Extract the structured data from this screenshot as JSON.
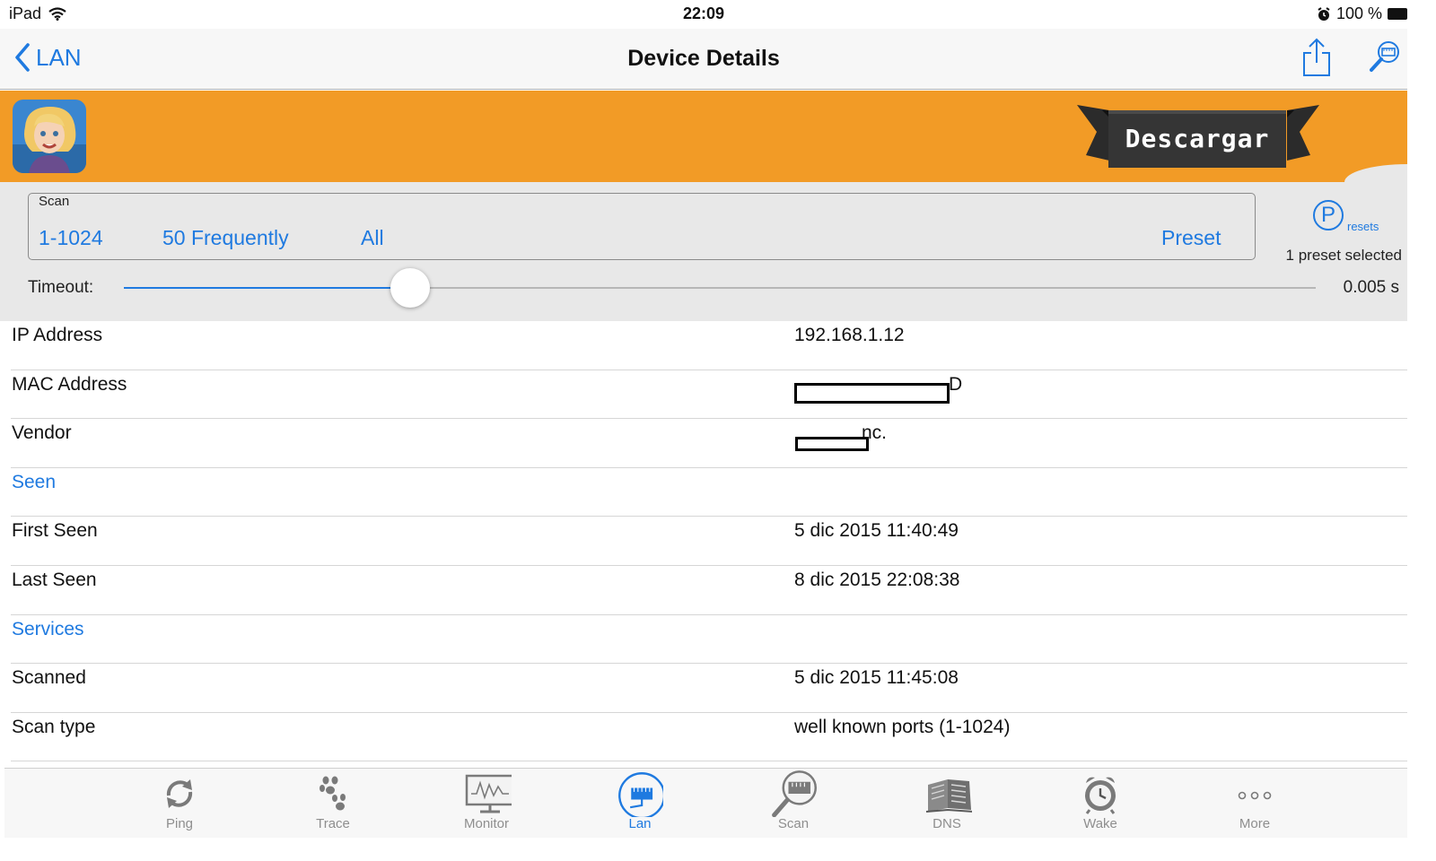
{
  "status_bar": {
    "device": "iPad",
    "time": "22:09",
    "battery": "100 %"
  },
  "nav": {
    "back_label": "LAN",
    "title": "Device Details"
  },
  "ad": {
    "button_label": "Descargar"
  },
  "scan": {
    "legend": "Scan",
    "options": [
      "1-1024",
      "50 Frequently",
      "All",
      "Preset"
    ],
    "presets_letter": "P",
    "presets_label": "resets",
    "preset_status": "1 preset selected",
    "timeout_label": "Timeout:",
    "timeout_value": "0.005 s",
    "timeout_fraction": 0.24
  },
  "details": {
    "ip_label": "IP Address",
    "ip_value": "192.168.1.12",
    "mac_label": "MAC Address",
    "mac_value": "D",
    "vendor_label": "Vendor",
    "vendor_value": "nc.",
    "seen_header": "Seen",
    "first_seen_label": "First Seen",
    "first_seen_value": "5 dic 2015 11:40:49",
    "last_seen_label": "Last Seen",
    "last_seen_value": "8 dic 2015 22:08:38",
    "services_header": "Services",
    "scanned_label": "Scanned",
    "scanned_value": "5 dic 2015 11:45:08",
    "scan_type_label": "Scan type",
    "scan_type_value": "well known ports (1-1024)"
  },
  "tabs": [
    {
      "label": "Ping",
      "icon": "ping-icon"
    },
    {
      "label": "Trace",
      "icon": "paw-icon"
    },
    {
      "label": "Monitor",
      "icon": "monitor-icon"
    },
    {
      "label": "Lan",
      "icon": "lan-icon",
      "active": true
    },
    {
      "label": "Scan",
      "icon": "scan-icon"
    },
    {
      "label": "DNS",
      "icon": "dns-icon"
    },
    {
      "label": "Wake",
      "icon": "alarm-clock-icon"
    },
    {
      "label": "More",
      "icon": "more-icon"
    }
  ],
  "colors": {
    "accent": "#1f7ae0",
    "ad_background": "#f29b26",
    "panel": "#e8e8e8"
  }
}
